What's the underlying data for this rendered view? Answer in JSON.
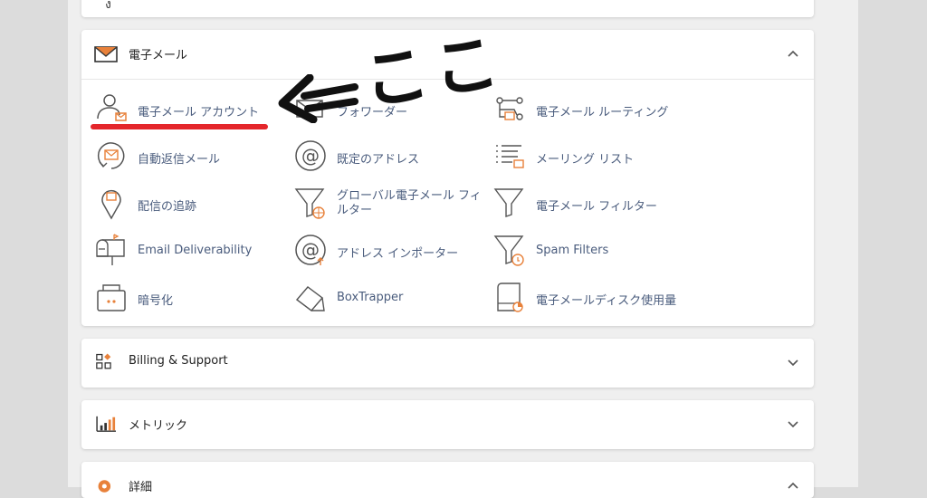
{
  "sections": {
    "email": {
      "title": "電子メール",
      "expanded": true
    },
    "billing": {
      "title": "Billing & Support"
    },
    "metrics": {
      "title": "メトリック"
    },
    "details": {
      "title": "詳細"
    }
  },
  "email_items": [
    {
      "label": "電子メール アカウント",
      "icon": "user-mail-icon"
    },
    {
      "label": "フォワーダー",
      "icon": "forwarder-icon"
    },
    {
      "label": "電子メール ルーティング",
      "icon": "routing-icon"
    },
    {
      "label": "自動返信メール",
      "icon": "autoresponder-icon"
    },
    {
      "label": "既定のアドレス",
      "icon": "at-icon"
    },
    {
      "label": "メーリング リスト",
      "icon": "mailing-list-icon"
    },
    {
      "label": "配信の追跡",
      "icon": "track-delivery-icon"
    },
    {
      "label": "グローバル電子メール フィルター",
      "icon": "global-filter-icon"
    },
    {
      "label": "電子メール フィルター",
      "icon": "filter-icon"
    },
    {
      "label": "Email Deliverability",
      "icon": "mailbox-icon"
    },
    {
      "label": "アドレス インポーター",
      "icon": "address-importer-icon"
    },
    {
      "label": "Spam Filters",
      "icon": "spam-filter-icon"
    },
    {
      "label": "暗号化",
      "icon": "encryption-icon"
    },
    {
      "label": "BoxTrapper",
      "icon": "boxtrapper-icon"
    },
    {
      "label": "電子メールディスク使用量",
      "icon": "disk-usage-icon"
    }
  ],
  "annotation": {
    "text": "⇐ここ",
    "underline_color": "#e4262b"
  },
  "colors": {
    "accent": "#e8813a",
    "link": "#4a5c7d",
    "icon": "#555555"
  }
}
